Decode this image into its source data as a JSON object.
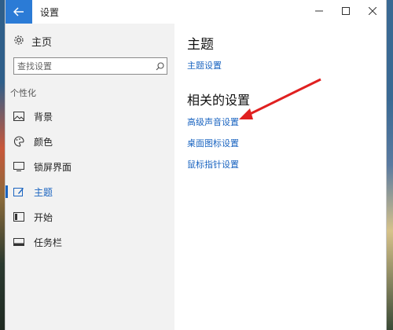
{
  "window": {
    "title": "设置"
  },
  "nav": {
    "home_label": "主页",
    "search_placeholder": "查找设置",
    "section_label": "个性化",
    "items": [
      {
        "label": "背景",
        "icon": "image-icon"
      },
      {
        "label": "颜色",
        "icon": "palette-icon"
      },
      {
        "label": "锁屏界面",
        "icon": "lock-screen-icon"
      },
      {
        "label": "主题",
        "icon": "theme-icon",
        "active": true
      },
      {
        "label": "开始",
        "icon": "start-icon"
      },
      {
        "label": "任务栏",
        "icon": "taskbar-icon"
      }
    ]
  },
  "content": {
    "title": "主题",
    "theme_settings_link": "主题设置",
    "related_title": "相关的设置",
    "related_links": [
      "高级声音设置",
      "桌面图标设置",
      "鼠标指针设置"
    ]
  },
  "colors": {
    "accent": "#1a64c0",
    "annotation_arrow": "#e02020"
  }
}
